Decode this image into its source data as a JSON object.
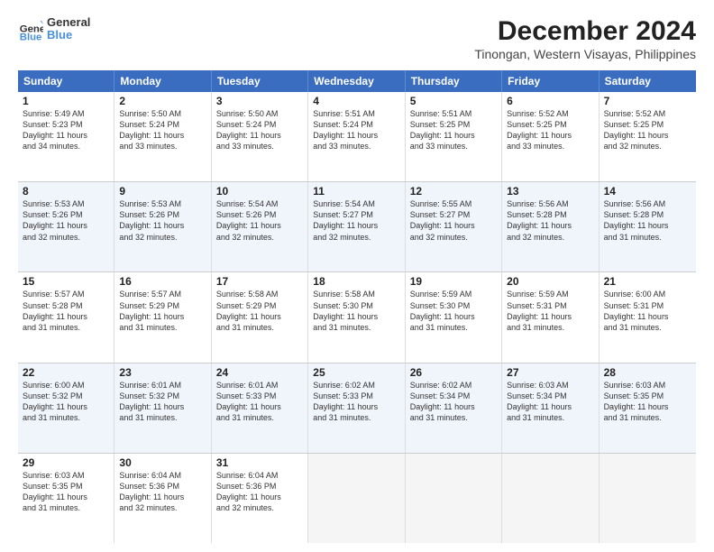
{
  "header": {
    "logo_line1": "General",
    "logo_line2": "Blue",
    "title": "December 2024",
    "subtitle": "Tinongan, Western Visayas, Philippines"
  },
  "days_of_week": [
    "Sunday",
    "Monday",
    "Tuesday",
    "Wednesday",
    "Thursday",
    "Friday",
    "Saturday"
  ],
  "weeks": [
    [
      {
        "day": "1",
        "info": "Sunrise: 5:49 AM\nSunset: 5:23 PM\nDaylight: 11 hours\nand 34 minutes.",
        "empty": false
      },
      {
        "day": "2",
        "info": "Sunrise: 5:50 AM\nSunset: 5:24 PM\nDaylight: 11 hours\nand 33 minutes.",
        "empty": false
      },
      {
        "day": "3",
        "info": "Sunrise: 5:50 AM\nSunset: 5:24 PM\nDaylight: 11 hours\nand 33 minutes.",
        "empty": false
      },
      {
        "day": "4",
        "info": "Sunrise: 5:51 AM\nSunset: 5:24 PM\nDaylight: 11 hours\nand 33 minutes.",
        "empty": false
      },
      {
        "day": "5",
        "info": "Sunrise: 5:51 AM\nSunset: 5:25 PM\nDaylight: 11 hours\nand 33 minutes.",
        "empty": false
      },
      {
        "day": "6",
        "info": "Sunrise: 5:52 AM\nSunset: 5:25 PM\nDaylight: 11 hours\nand 33 minutes.",
        "empty": false
      },
      {
        "day": "7",
        "info": "Sunrise: 5:52 AM\nSunset: 5:25 PM\nDaylight: 11 hours\nand 32 minutes.",
        "empty": false
      }
    ],
    [
      {
        "day": "8",
        "info": "Sunrise: 5:53 AM\nSunset: 5:26 PM\nDaylight: 11 hours\nand 32 minutes.",
        "empty": false
      },
      {
        "day": "9",
        "info": "Sunrise: 5:53 AM\nSunset: 5:26 PM\nDaylight: 11 hours\nand 32 minutes.",
        "empty": false
      },
      {
        "day": "10",
        "info": "Sunrise: 5:54 AM\nSunset: 5:26 PM\nDaylight: 11 hours\nand 32 minutes.",
        "empty": false
      },
      {
        "day": "11",
        "info": "Sunrise: 5:54 AM\nSunset: 5:27 PM\nDaylight: 11 hours\nand 32 minutes.",
        "empty": false
      },
      {
        "day": "12",
        "info": "Sunrise: 5:55 AM\nSunset: 5:27 PM\nDaylight: 11 hours\nand 32 minutes.",
        "empty": false
      },
      {
        "day": "13",
        "info": "Sunrise: 5:56 AM\nSunset: 5:28 PM\nDaylight: 11 hours\nand 32 minutes.",
        "empty": false
      },
      {
        "day": "14",
        "info": "Sunrise: 5:56 AM\nSunset: 5:28 PM\nDaylight: 11 hours\nand 31 minutes.",
        "empty": false
      }
    ],
    [
      {
        "day": "15",
        "info": "Sunrise: 5:57 AM\nSunset: 5:28 PM\nDaylight: 11 hours\nand 31 minutes.",
        "empty": false
      },
      {
        "day": "16",
        "info": "Sunrise: 5:57 AM\nSunset: 5:29 PM\nDaylight: 11 hours\nand 31 minutes.",
        "empty": false
      },
      {
        "day": "17",
        "info": "Sunrise: 5:58 AM\nSunset: 5:29 PM\nDaylight: 11 hours\nand 31 minutes.",
        "empty": false
      },
      {
        "day": "18",
        "info": "Sunrise: 5:58 AM\nSunset: 5:30 PM\nDaylight: 11 hours\nand 31 minutes.",
        "empty": false
      },
      {
        "day": "19",
        "info": "Sunrise: 5:59 AM\nSunset: 5:30 PM\nDaylight: 11 hours\nand 31 minutes.",
        "empty": false
      },
      {
        "day": "20",
        "info": "Sunrise: 5:59 AM\nSunset: 5:31 PM\nDaylight: 11 hours\nand 31 minutes.",
        "empty": false
      },
      {
        "day": "21",
        "info": "Sunrise: 6:00 AM\nSunset: 5:31 PM\nDaylight: 11 hours\nand 31 minutes.",
        "empty": false
      }
    ],
    [
      {
        "day": "22",
        "info": "Sunrise: 6:00 AM\nSunset: 5:32 PM\nDaylight: 11 hours\nand 31 minutes.",
        "empty": false
      },
      {
        "day": "23",
        "info": "Sunrise: 6:01 AM\nSunset: 5:32 PM\nDaylight: 11 hours\nand 31 minutes.",
        "empty": false
      },
      {
        "day": "24",
        "info": "Sunrise: 6:01 AM\nSunset: 5:33 PM\nDaylight: 11 hours\nand 31 minutes.",
        "empty": false
      },
      {
        "day": "25",
        "info": "Sunrise: 6:02 AM\nSunset: 5:33 PM\nDaylight: 11 hours\nand 31 minutes.",
        "empty": false
      },
      {
        "day": "26",
        "info": "Sunrise: 6:02 AM\nSunset: 5:34 PM\nDaylight: 11 hours\nand 31 minutes.",
        "empty": false
      },
      {
        "day": "27",
        "info": "Sunrise: 6:03 AM\nSunset: 5:34 PM\nDaylight: 11 hours\nand 31 minutes.",
        "empty": false
      },
      {
        "day": "28",
        "info": "Sunrise: 6:03 AM\nSunset: 5:35 PM\nDaylight: 11 hours\nand 31 minutes.",
        "empty": false
      }
    ],
    [
      {
        "day": "29",
        "info": "Sunrise: 6:03 AM\nSunset: 5:35 PM\nDaylight: 11 hours\nand 31 minutes.",
        "empty": false
      },
      {
        "day": "30",
        "info": "Sunrise: 6:04 AM\nSunset: 5:36 PM\nDaylight: 11 hours\nand 32 minutes.",
        "empty": false
      },
      {
        "day": "31",
        "info": "Sunrise: 6:04 AM\nSunset: 5:36 PM\nDaylight: 11 hours\nand 32 minutes.",
        "empty": false
      },
      {
        "day": "",
        "info": "",
        "empty": true
      },
      {
        "day": "",
        "info": "",
        "empty": true
      },
      {
        "day": "",
        "info": "",
        "empty": true
      },
      {
        "day": "",
        "info": "",
        "empty": true
      }
    ]
  ]
}
